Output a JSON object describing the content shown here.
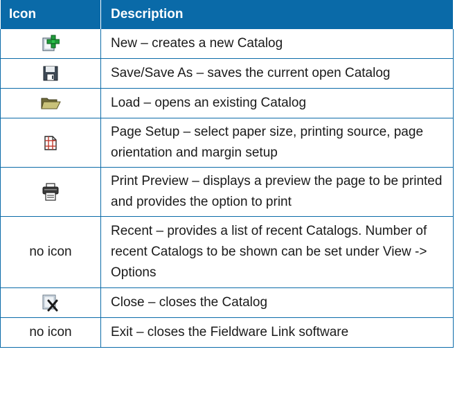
{
  "table": {
    "headers": {
      "icon": "Icon",
      "description": "Description"
    },
    "rows": [
      {
        "icon": "new-catalog-icon",
        "icon_text": "",
        "description": "New – creates a new Catalog"
      },
      {
        "icon": "save-icon",
        "icon_text": "",
        "description": "Save/Save As – saves the current open Catalog"
      },
      {
        "icon": "open-folder-icon",
        "icon_text": "",
        "description": "Load – opens an existing Catalog"
      },
      {
        "icon": "page-setup-icon",
        "icon_text": "",
        "description": "Page Setup – select paper size, printing source, page orientation and margin setup"
      },
      {
        "icon": "printer-icon",
        "icon_text": "",
        "description": "Print Preview – displays a preview the page to be printed and provides the option to print"
      },
      {
        "icon": "",
        "icon_text": "no icon",
        "description": "Recent – provides a list of recent Catalogs. Number of recent Catalogs to be shown can be set under View -> Options"
      },
      {
        "icon": "close-catalog-icon",
        "icon_text": "",
        "description": "Close – closes the Catalog"
      },
      {
        "icon": "",
        "icon_text": "no icon",
        "description": "Exit – closes the Fieldware Link software"
      }
    ]
  },
  "colors": {
    "header_bg": "#0a6aa8",
    "border": "#0a6aa8"
  }
}
